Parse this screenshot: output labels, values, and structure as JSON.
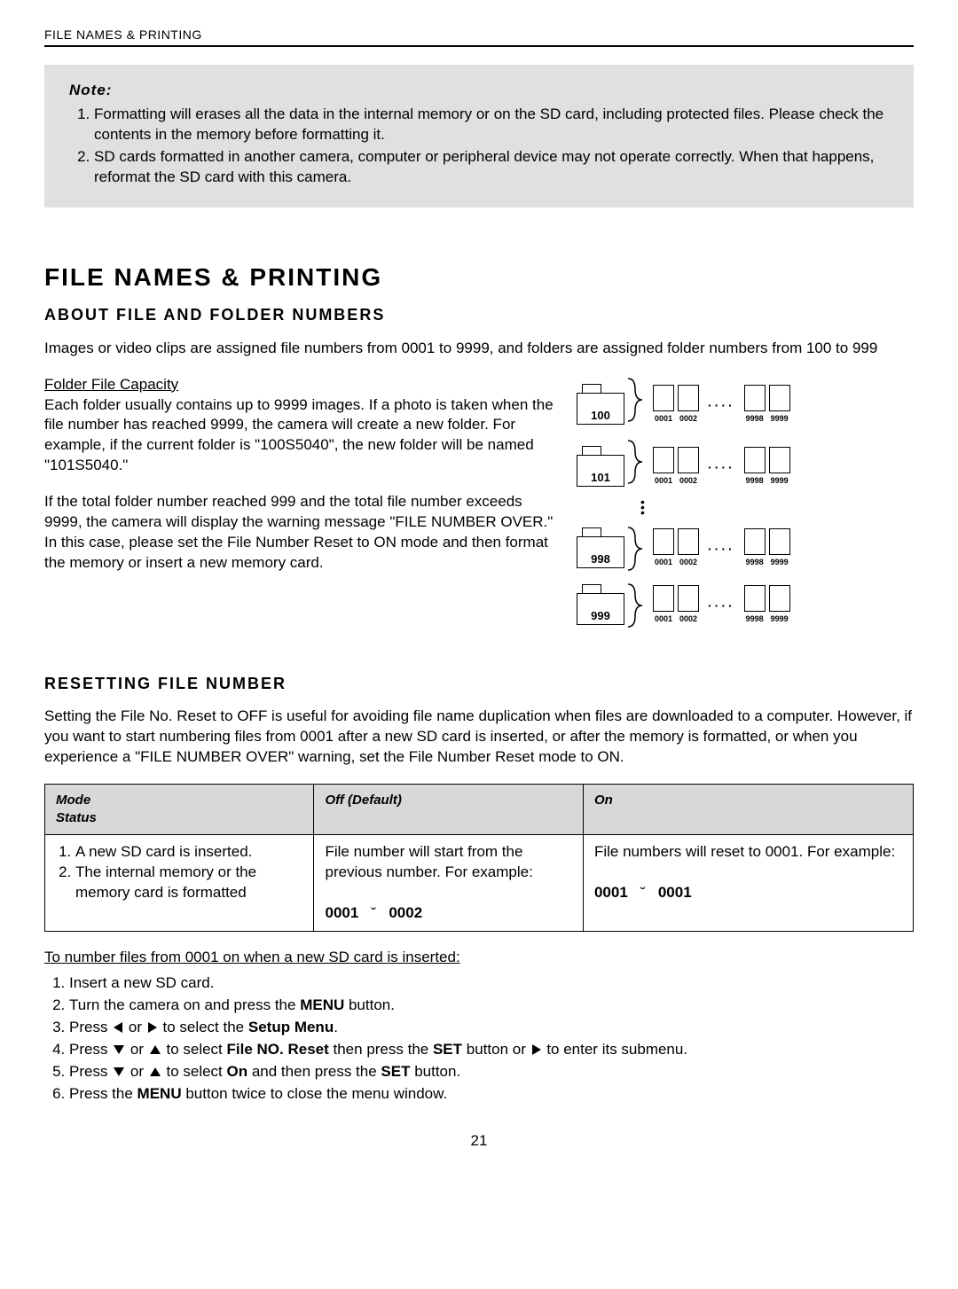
{
  "header": {
    "running_head": "FILE NAMES & PRINTING"
  },
  "note_box": {
    "label": "Note:",
    "items": [
      "Formatting will erases all the data in the internal memory or on the SD card, including protected files. Please check the contents in the memory before formatting it.",
      "SD cards formatted in another camera, computer or peripheral device may not operate correctly. When that happens, reformat the SD card with this camera."
    ]
  },
  "section": {
    "title": "FILE NAMES & PRINTING",
    "sub_title": "ABOUT FILE AND FOLDER NUMBERS",
    "intro": "Images or video clips are assigned file numbers from 0001 to 9999, and folders are assigned folder numbers from 100 to 999",
    "folder_cap_heading": "Folder File Capacity",
    "folder_cap_p1": "Each folder usually contains up to 9999 images. If a photo is taken when the file number has reached 9999, the camera will create a new folder. For example, if the current folder is \"100S5040\", the new folder will be named \"101S5040.\"",
    "folder_cap_p2": "If the total folder number reached 999 and the total file number exceeds 9999, the camera will display the warning message \"FILE NUMBER OVER.\" In this case, please set the File Number Reset to ON mode and then format the memory or insert a new memory card."
  },
  "diagram": {
    "rows": [
      {
        "folder": "100",
        "left": [
          "0001",
          "0002"
        ],
        "right": [
          "9998",
          "9999"
        ]
      },
      {
        "folder": "101",
        "left": [
          "0001",
          "0002"
        ],
        "right": [
          "9998",
          "9999"
        ]
      },
      {
        "folder": "998",
        "left": [
          "0001",
          "0002"
        ],
        "right": [
          "9998",
          "9999"
        ]
      },
      {
        "folder": "999",
        "left": [
          "0001",
          "0002"
        ],
        "right": [
          "9998",
          "9999"
        ]
      }
    ]
  },
  "reset": {
    "title": "RESETTING FILE NUMBER",
    "intro": "Setting the File No. Reset to OFF is useful for avoiding file name duplication when files are downloaded to a computer. However, if you want to start numbering files from 0001 after a new SD card is inserted, or after the memory is formatted, or when you experience a \"FILE NUMBER OVER\" warning, set the File Number Reset mode to ON.",
    "table": {
      "mode_label": "Mode",
      "status_label": "Status",
      "off_label": "Off (Default)",
      "on_label": "On",
      "situation_items": [
        "A new SD card is inserted.",
        "The internal memory or the memory card is formatted"
      ],
      "off_desc": "File number will start from the previous number. For example:",
      "off_ex_left": "0001",
      "off_ex_right": "0002",
      "on_desc": "File numbers will reset to 0001. For example:",
      "on_ex_left": "0001",
      "on_ex_right": "0001"
    },
    "steps_heading": "To number files from 0001 on when a new SD card is inserted:",
    "steps": {
      "s1": "Insert a new SD card.",
      "s2_pre": "Turn the camera on and press the ",
      "s2_bold": "MENU",
      "s2_post": " button.",
      "s3_pre": "Press ",
      "s3_mid": " or ",
      "s3_post": " to select the ",
      "s3_bold": "Setup Menu",
      "s3_end": ".",
      "s4_pre": "Press ",
      "s4_mid": " or ",
      "s4_post": " to select ",
      "s4_bold1": "File NO. Reset",
      "s4_then": " then press the ",
      "s4_bold2": "SET",
      "s4_or": " button or ",
      "s4_end": " to enter its submenu.",
      "s5_pre": "Press ",
      "s5_mid": " or ",
      "s5_post": " to select ",
      "s5_bold1": "On",
      "s5_then": " and then press the ",
      "s5_bold2": "SET",
      "s5_end": " button.",
      "s6_pre": "Press the ",
      "s6_bold": "MENU",
      "s6_post": " button twice to close the menu window."
    }
  },
  "page_number": "21"
}
